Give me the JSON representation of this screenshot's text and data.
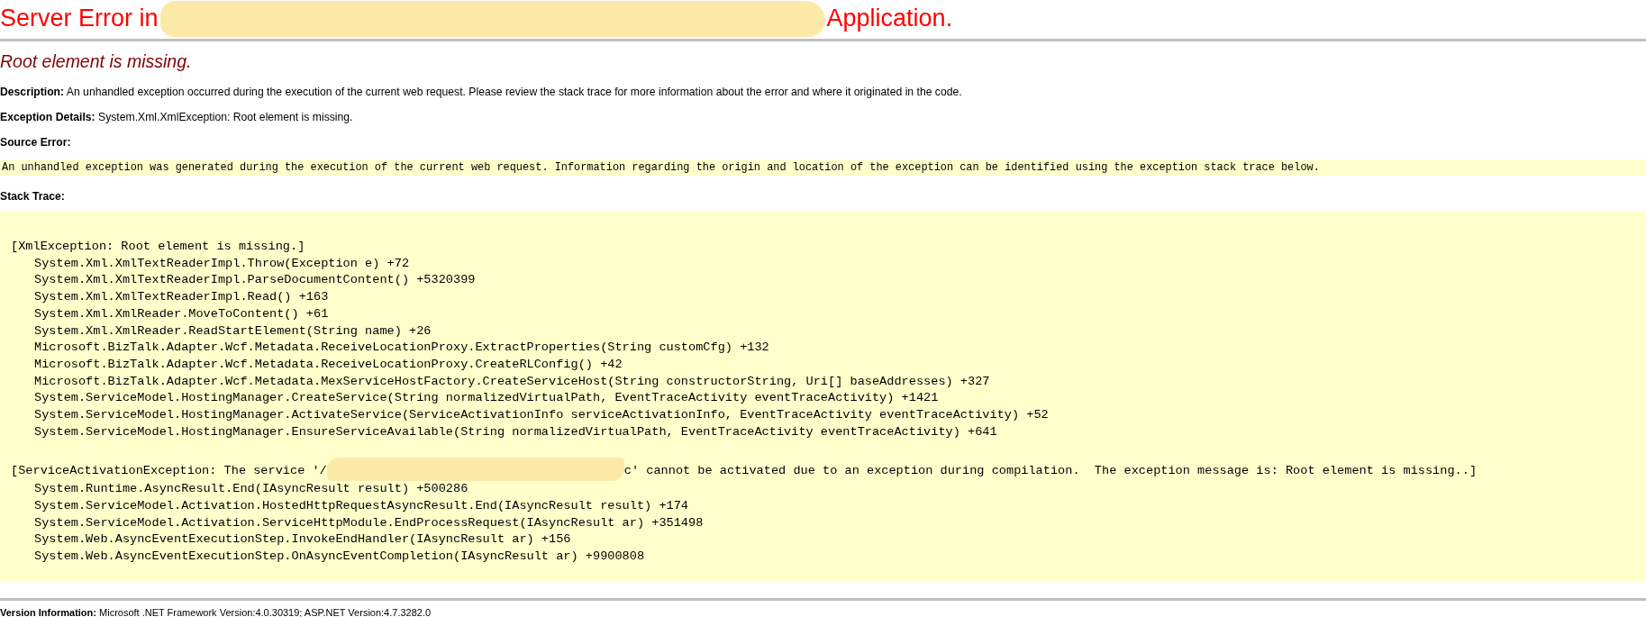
{
  "title": [
    "Server Error in",
    "Application."
  ],
  "error_message": "Root element is missing.",
  "description": "**Description:** An unhandled exception occurred during the execution of the current web request. Please review the stack trace for more information about the error and where it originated in the code.",
  "exception_details": "**Exception Details:** System.Xml.XmlException: Root element is missing.",
  "source_error": {
    "label": "Source Error:",
    "text": "An unhandled exception was generated during the execution of the current web request. Information regarding the origin and location of the exception can be identified using the exception stack trace below."
  },
  "stack_trace": {
    "label": "Stack Trace:",
    "groups": [
      {
        "exception": [
          "[XmlException: Root element is missing.]"
        ],
        "frames": [
          "System.Xml.XmlTextReaderImpl.Throw(Exception e) +72",
          "System.Xml.XmlTextReaderImpl.ParseDocumentContent() +5320399",
          "System.Xml.XmlTextReaderImpl.Read() +163",
          "System.Xml.XmlReader.MoveToContent() +61",
          "System.Xml.XmlReader.ReadStartElement(String name) +26",
          "Microsoft.BizTalk.Adapter.Wcf.Metadata.ReceiveLocationProxy.ExtractProperties(String customCfg) +132",
          "Microsoft.BizTalk.Adapter.Wcf.Metadata.ReceiveLocationProxy.CreateRLConfig() +42",
          "Microsoft.BizTalk.Adapter.Wcf.Metadata.MexServiceHostFactory.CreateServiceHost(String constructorString, Uri[] baseAddresses) +327",
          "System.ServiceModel.HostingManager.CreateService(String normalizedVirtualPath, EventTraceActivity eventTraceActivity) +1421",
          "System.ServiceModel.HostingManager.ActivateService(ServiceActivationInfo serviceActivationInfo, EventTraceActivity eventTraceActivity) +52",
          "System.ServiceModel.HostingManager.EnsureServiceAvailable(String normalizedVirtualPath, EventTraceActivity eventTraceActivity) +641"
        ]
      },
      {
        "exception": [
          "[ServiceActivationException: The service '/",
          "c' cannot be activated due to an exception during compilation.  The exception message is: Root element is missing..]"
        ],
        "frames": [
          "System.Runtime.AsyncResult.End(IAsyncResult result) +500286",
          "System.ServiceModel.Activation.HostedHttpRequestAsyncResult.End(IAsyncResult result) +174",
          "System.ServiceModel.Activation.ServiceHttpModule.EndProcessRequest(IAsyncResult ar) +351498",
          "System.Web.AsyncEventExecutionStep.InvokeEndHandler(IAsyncResult ar) +156",
          "System.Web.AsyncEventExecutionStep.OnAsyncEventCompletion(IAsyncResult ar) +9900808"
        ]
      }
    ]
  },
  "version_information": "**Version Information:** Microsoft .NET Framework Version:4.0.30319; ASP.NET Version:4.7.3282.0"
}
